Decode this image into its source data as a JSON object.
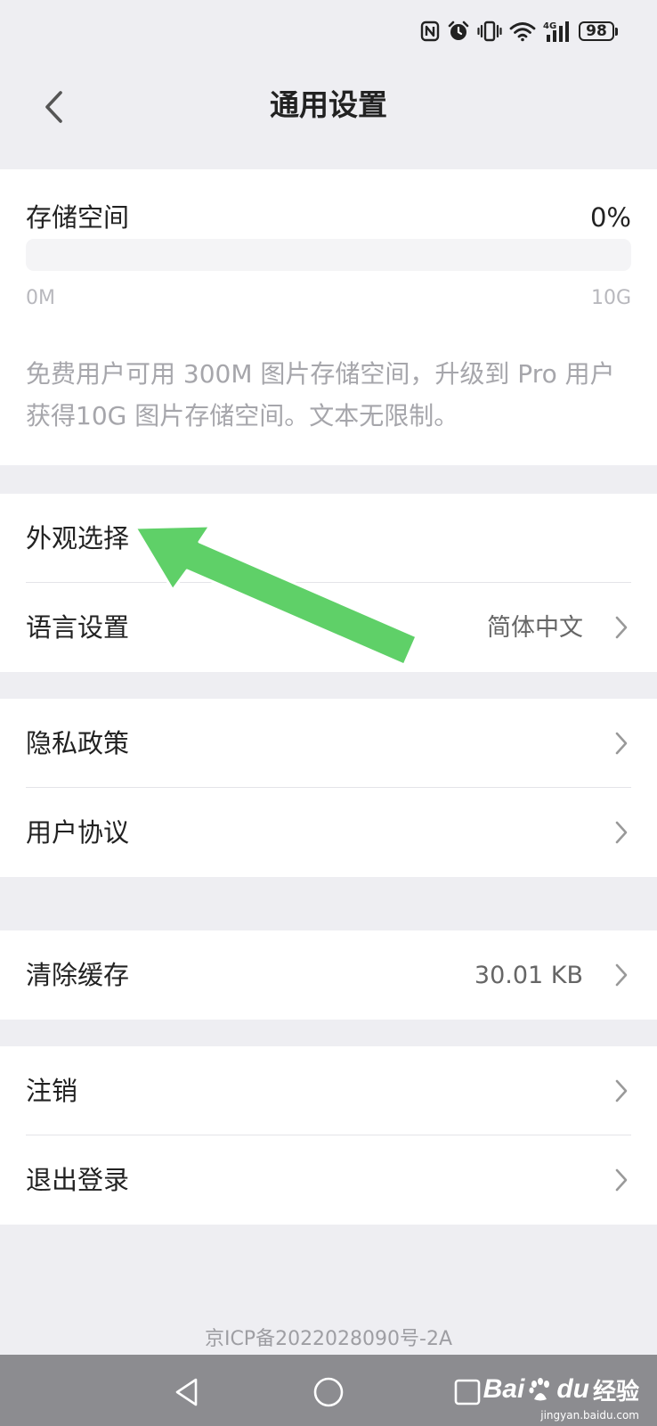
{
  "status_bar": {
    "icons": [
      "nfc-icon",
      "alarm-icon",
      "vibrate-icon",
      "wifi-icon",
      "signal-4g-icon",
      "battery-icon"
    ],
    "network_label": "4G",
    "battery_level": "98"
  },
  "header": {
    "title": "通用设置",
    "back_icon": "chevron-left-icon"
  },
  "storage": {
    "label": "存储空间",
    "percent_text": "0%",
    "used_fraction": 0,
    "range_min": "0M",
    "range_max": "10G",
    "description": "免费用户可用 300M 图片存储空间，升级到 Pro 用户获得10G 图片存储空间。文本无限制。"
  },
  "settings": {
    "appearance": {
      "label": "外观选择"
    },
    "language": {
      "label": "语言设置",
      "value": "简体中文"
    },
    "privacy": {
      "label": "隐私政策"
    },
    "user_agreement": {
      "label": "用户协议"
    },
    "clear_cache": {
      "label": "清除缓存",
      "value": "30.01 KB"
    },
    "deactivate": {
      "label": "注销"
    },
    "logout": {
      "label": "退出登录"
    }
  },
  "footer": {
    "icp": "京ICP备2022028090号-2A"
  },
  "annotation": {
    "arrow_color": "#5fd068"
  },
  "nav_bar": {
    "buttons": [
      "back-triangle-icon",
      "home-circle-icon",
      "recents-square-icon"
    ]
  },
  "watermark": {
    "brand_left": "Bai",
    "brand_right": "du",
    "product": "经验",
    "url": "jingyan.baidu.com"
  },
  "colors": {
    "background": "#eeeef2",
    "card": "#ffffff",
    "text_primary": "#222222",
    "text_secondary": "#666666",
    "text_muted": "#a6a6ab",
    "nav_bar": "#8c8c90"
  }
}
